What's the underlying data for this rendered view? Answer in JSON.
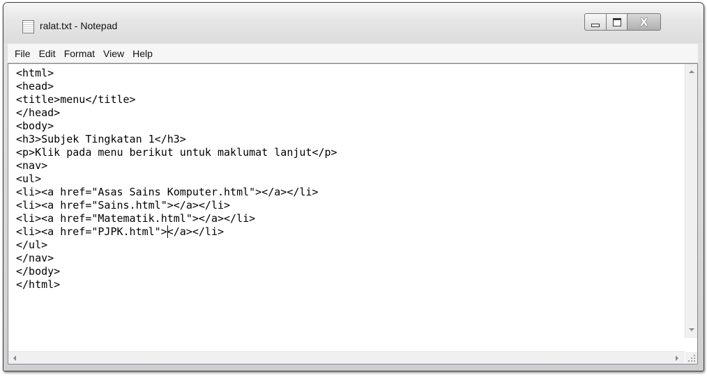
{
  "window": {
    "title": "ralat.txt - Notepad",
    "close_glyph": "X"
  },
  "menu": {
    "items": [
      "File",
      "Edit",
      "Format",
      "View",
      "Help"
    ]
  },
  "editor": {
    "lines": [
      "<html>",
      "<head>",
      "<title>menu</title>",
      "</head>",
      "<body>",
      "<h3>Subjek Tingkatan 1</h3>",
      "<p>Klik pada menu berikut untuk maklumat lanjut</p>",
      "<nav>",
      "<ul>",
      "<li><a href=\"Asas Sains Komputer.html\"></a></li>",
      "<li><a href=\"Sains.html\"></a></li>",
      "<li><a href=\"Matematik.html\"></a></li>",
      "<li><a href=\"PJPK.html\">",
      "</ul>",
      "</nav>",
      "</body>",
      "</html>"
    ],
    "caret_after": "</a></li>"
  }
}
